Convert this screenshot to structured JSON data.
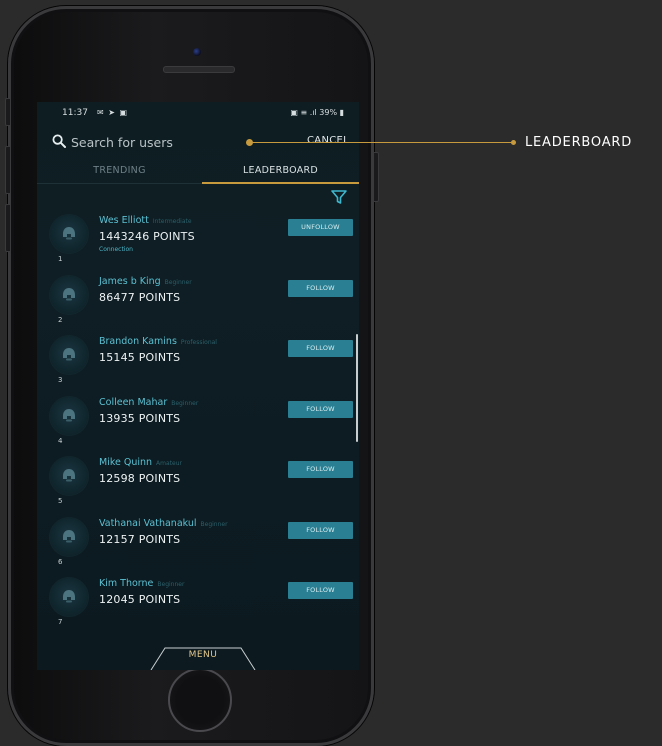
{
  "status_bar": {
    "time": "11:37",
    "left_icons": "✉ ➤ ▣",
    "right_text": "▣ ≡ .ıl 39% ▮"
  },
  "search": {
    "placeholder": "Search for users",
    "cancel_label": "CANCEL"
  },
  "tabs": [
    {
      "label": "TRENDING",
      "active": false
    },
    {
      "label": "LEADERBOARD",
      "active": true
    }
  ],
  "leaderboard": [
    {
      "rank": "1",
      "name": "Wes Elliott",
      "level": "Intermediate",
      "points": "1443246 POINTS",
      "status": "Connection",
      "button": "UNFOLLOW"
    },
    {
      "rank": "2",
      "name": "James b King",
      "level": "Beginner",
      "points": "86477 POINTS",
      "status": "",
      "button": "FOLLOW"
    },
    {
      "rank": "3",
      "name": "Brandon Kamins",
      "level": "Professional",
      "points": "15145 POINTS",
      "status": "",
      "button": "FOLLOW"
    },
    {
      "rank": "4",
      "name": "Colleen Mahar",
      "level": "Beginner",
      "points": "13935 POINTS",
      "status": "",
      "button": "FOLLOW"
    },
    {
      "rank": "5",
      "name": "Mike Quinn",
      "level": "Amateur",
      "points": "12598 POINTS",
      "status": "",
      "button": "FOLLOW"
    },
    {
      "rank": "6",
      "name": "Vathanai Vathanakul",
      "level": "Beginner",
      "points": "12157 POINTS",
      "status": "",
      "button": "FOLLOW"
    },
    {
      "rank": "7",
      "name": "Kim Thorne",
      "level": "Beginner",
      "points": "12045 POINTS",
      "status": "",
      "button": "FOLLOW"
    }
  ],
  "bottom_nav": {
    "menu_label": "MENU"
  },
  "callout": {
    "label": "LEADERBOARD"
  },
  "icons": {
    "search": "search-icon",
    "filter": "filter-icon",
    "avatar": "helmet-icon"
  },
  "colors": {
    "accent_gold": "#c79a3e",
    "follow_button": "#2b7f92",
    "username": "#5bc1d3",
    "screen_bg": "#0d1d22",
    "page_bg": "#2b2b2c"
  }
}
